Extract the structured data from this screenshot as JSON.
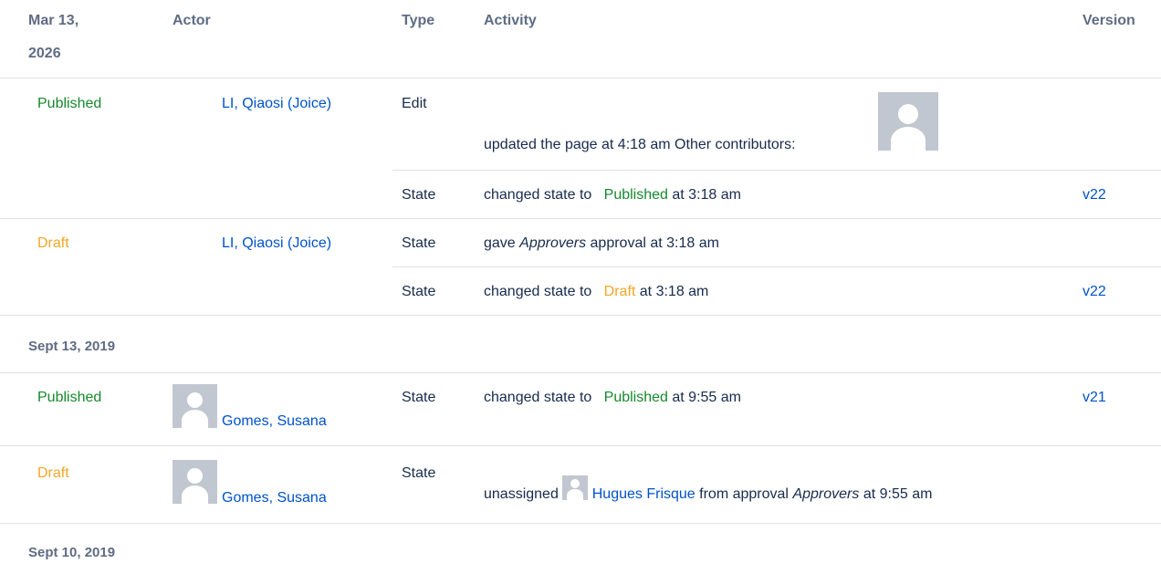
{
  "header": {
    "date": "Mar 13,",
    "date_year": "2026",
    "actor": "Actor",
    "type": "Type",
    "activity": "Activity",
    "version": "Version"
  },
  "groups": [
    {
      "status": "Published",
      "actor": "LI, Qiaosi (Joice)",
      "rows": [
        {
          "type": "Edit",
          "activity": "updated the page at 4:18 am Other contributors:"
        },
        {
          "type": "State",
          "pre": "changed state to",
          "state": "Published",
          "post": "at 3:18 am",
          "version": "v22"
        }
      ]
    },
    {
      "status": "Draft",
      "actor": "LI, Qiaosi (Joice)",
      "rows": [
        {
          "type": "State",
          "pre": "gave",
          "italic": "Approvers",
          "post": "approval at 3:18 am"
        },
        {
          "type": "State",
          "pre": "changed state to",
          "state": "Draft",
          "post": "at 3:18 am",
          "version": "v22"
        }
      ]
    }
  ],
  "section2_date": "Sept 13, 2019",
  "groups2": [
    {
      "status": "Published",
      "actor": "Gomes, Susana",
      "type": "State",
      "pre": "changed state to",
      "state": "Published",
      "post": "at 9:55 am",
      "version": "v21"
    },
    {
      "status": "Draft",
      "actor": "Gomes, Susana",
      "type": "State",
      "pre": "unassigned",
      "user": "Hugues Frisque",
      "mid": "from approval",
      "italic": "Approvers",
      "post": "at 9:55 am"
    }
  ],
  "section3_date": "Sept 10, 2019",
  "colors": {
    "published": "#14892c",
    "draft": "#f5a623",
    "link": "#0052cc",
    "header": "#5e6c84",
    "avatar_bg": "#c1c7d0"
  }
}
